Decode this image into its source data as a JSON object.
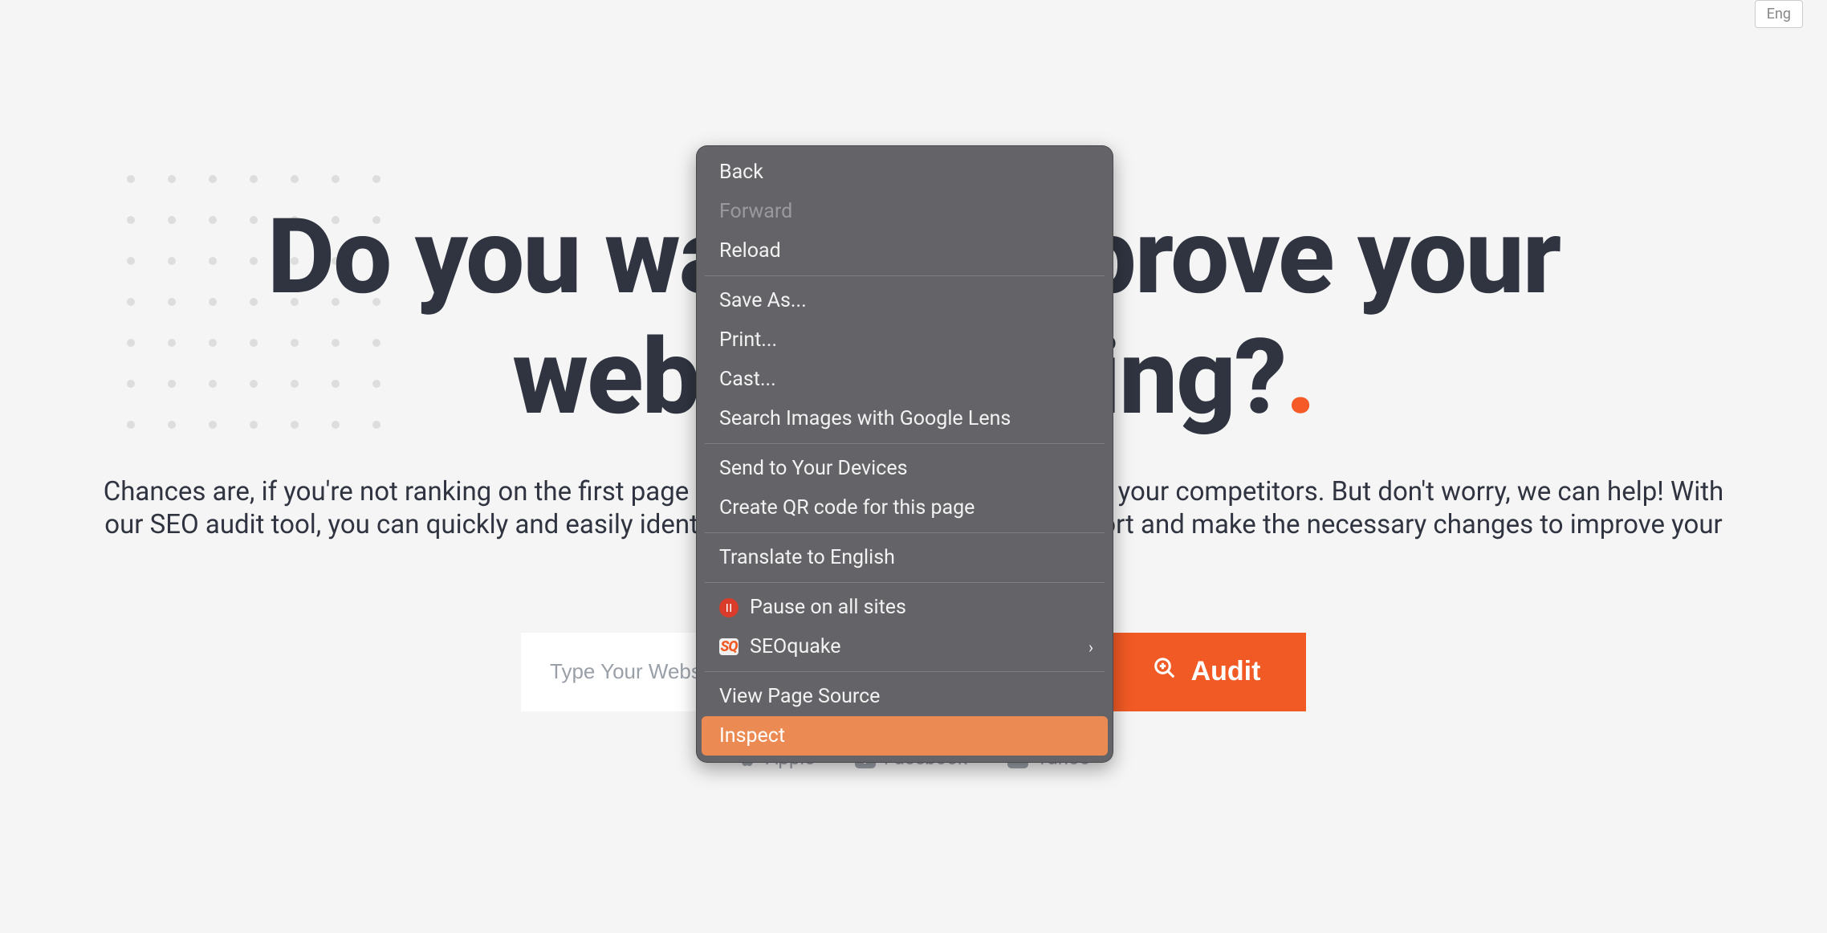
{
  "hero": {
    "title_line1": "Do you want to improve your",
    "title_line2": "website ranking?",
    "subtext": "Chances are, if you're not ranking on the first page of Google, you're losing business to your competitors. But don't worry, we can help! With our SEO audit tool, you can quickly and easily identify where your website is falling short and make the necessary changes to improve your ranking."
  },
  "search": {
    "placeholder": "Type Your Website Address",
    "button_label": "Audit"
  },
  "brands": {
    "apple": "Apple",
    "facebook": "Facebook",
    "yahoo": "Yahoo"
  },
  "context_menu": {
    "back": "Back",
    "forward": "Forward",
    "reload": "Reload",
    "save_as": "Save As...",
    "print": "Print...",
    "cast": "Cast...",
    "search_images": "Search Images with Google Lens",
    "send_devices": "Send to Your Devices",
    "create_qr": "Create QR code for this page",
    "translate": "Translate to English",
    "pause": "Pause on all sites",
    "seoquake": "SEOquake",
    "view_source": "View Page Source",
    "inspect": "Inspect"
  },
  "lang": {
    "label": "Eng"
  }
}
